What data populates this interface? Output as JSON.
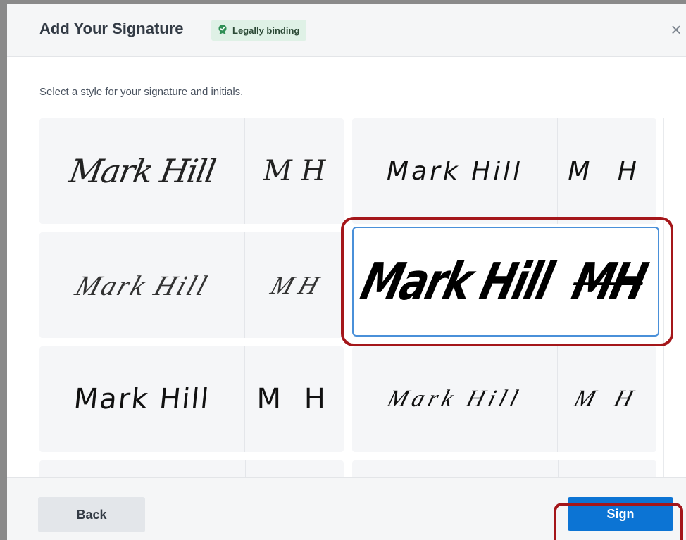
{
  "dialog": {
    "title": "Add Your Signature",
    "badge": {
      "icon": "verified-ribbon-icon",
      "label": "Legally binding",
      "color": "#2f8f55"
    },
    "close_icon": "×",
    "instruction": "Select a style for your signature and initials."
  },
  "styles": [
    {
      "full": "Mark Hill",
      "initials": "M H"
    },
    {
      "full": "Mark Hill",
      "initials": "M H"
    },
    {
      "full": "Mark Hill",
      "initials": "M H"
    },
    {
      "full": "Mark Hill",
      "initials": "MH",
      "selected": true
    },
    {
      "full": "Mark Hill",
      "initials": "M H"
    },
    {
      "full": "Mark Hill",
      "initials": "M H"
    }
  ],
  "footer": {
    "back_label": "Back",
    "sign_label": "Sign"
  },
  "colors": {
    "primary": "#0c74d4",
    "selected_border": "#4a90d9",
    "annotation": "#a4161a"
  }
}
